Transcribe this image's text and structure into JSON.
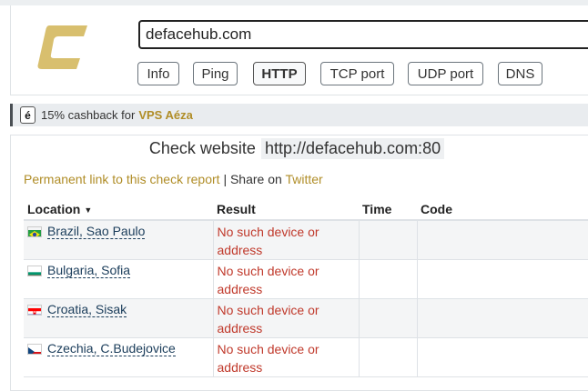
{
  "header": {
    "search_value": "defacehub.com",
    "buttons": [
      {
        "label": "Info",
        "active": false
      },
      {
        "label": "Ping",
        "active": false
      },
      {
        "label": "HTTP",
        "active": true
      },
      {
        "label": "TCP port",
        "active": false
      },
      {
        "label": "UDP port",
        "active": false
      },
      {
        "label": "DNS",
        "active": false
      }
    ]
  },
  "promo": {
    "badge": "é",
    "text": "15% cashback for",
    "link": "VPS Aéza"
  },
  "check": {
    "title": "Check website",
    "url": "http://defacehub.com:80",
    "permalink": "Permanent link to this check report",
    "separator": "|",
    "share_text": "Share on",
    "share_link": "Twitter"
  },
  "table": {
    "headers": {
      "location": "Location",
      "result": "Result",
      "time": "Time",
      "code": "Code"
    },
    "rows": [
      {
        "location": "Brazil, Sao Paulo",
        "flag": "brazil",
        "result_line1": "No such device or",
        "result_line2": "address",
        "time": "",
        "code": ""
      },
      {
        "location": "Bulgaria, Sofia",
        "flag": "bulgaria",
        "result_line1": "No such device or",
        "result_line2": "address",
        "time": "",
        "code": ""
      },
      {
        "location": "Croatia, Sisak",
        "flag": "croatia",
        "result_line1": "No such device or",
        "result_line2": "address",
        "time": "",
        "code": ""
      },
      {
        "location": "Czechia, C.Budejovice",
        "flag": "czechia",
        "result_line1": "No such device or",
        "result_line2": "address",
        "time": "",
        "code": ""
      }
    ]
  },
  "colors": {
    "accent": "#b08d27",
    "logo": "#d8bf6e",
    "error": "#c0392b",
    "location_link": "#1a3c5a"
  }
}
